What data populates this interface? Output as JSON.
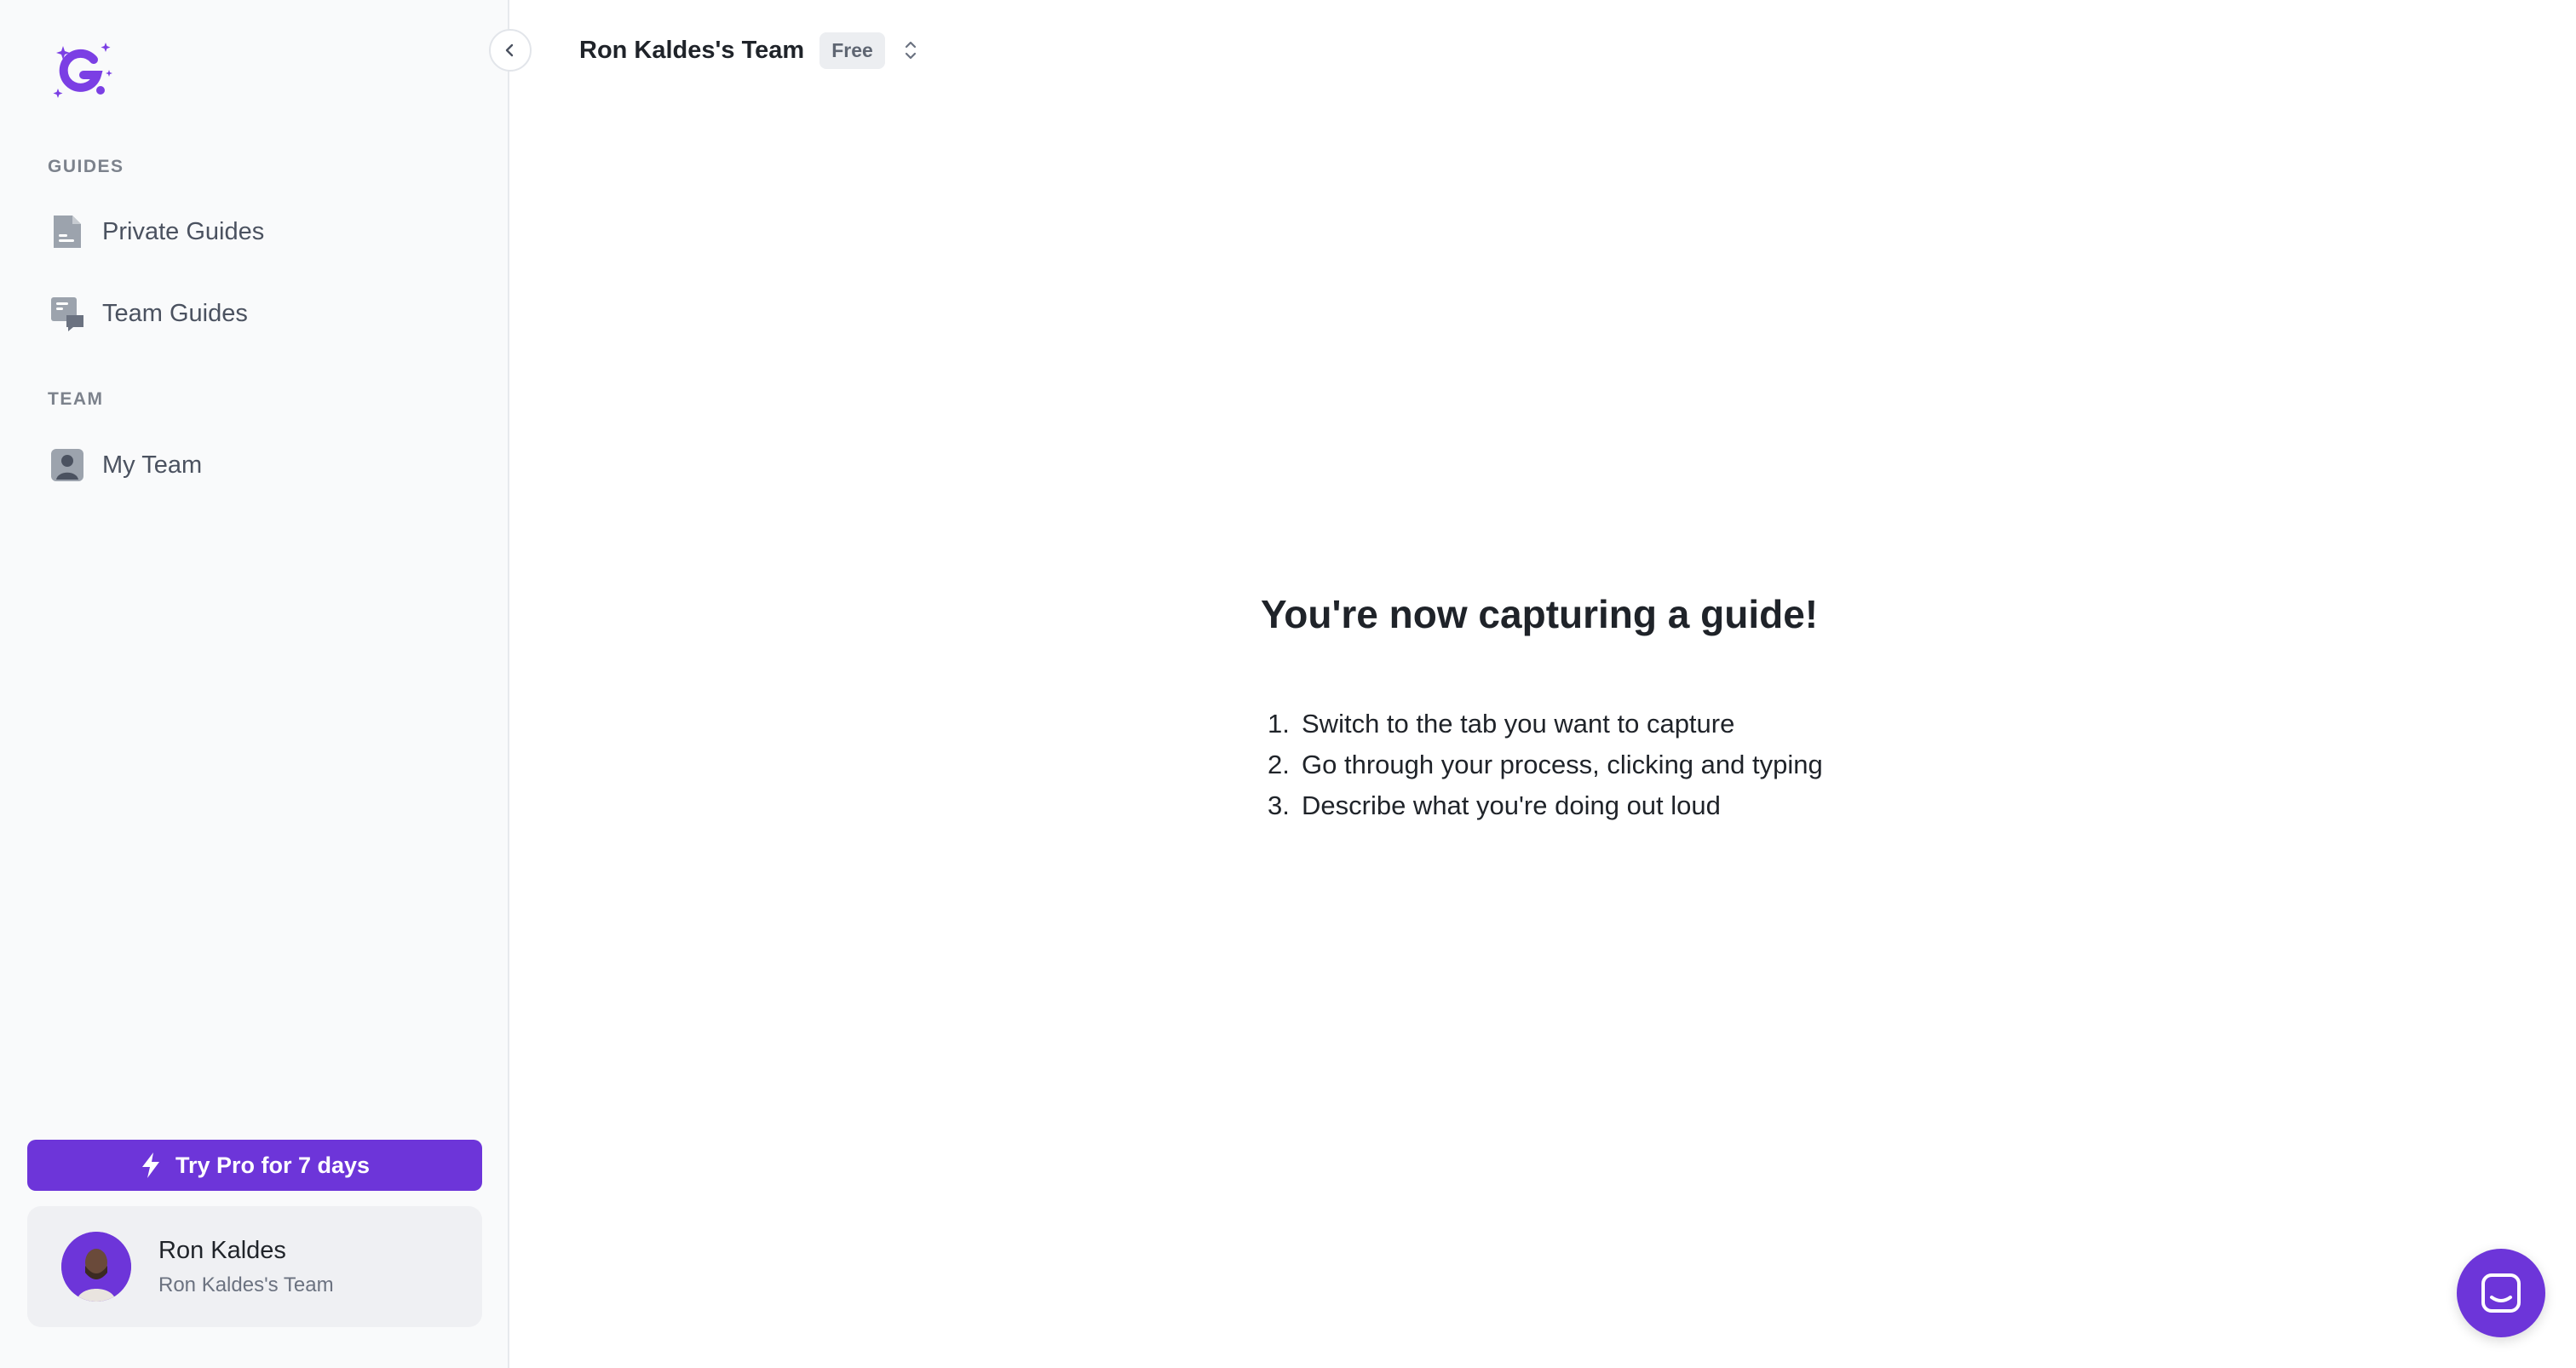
{
  "sidebar": {
    "sections": [
      {
        "label": "GUIDES"
      },
      {
        "label": "TEAM"
      }
    ],
    "items": [
      {
        "label": "Private Guides",
        "icon": "document-icon"
      },
      {
        "label": "Team Guides",
        "icon": "team-guides-icon"
      },
      {
        "label": "My Team",
        "icon": "person-icon"
      }
    ],
    "pro_button": {
      "label": "Try Pro for 7 days",
      "icon": "lightning-icon"
    },
    "user": {
      "name": "Ron Kaldes",
      "team": "Ron Kaldes's Team"
    }
  },
  "header": {
    "team_name": "Ron Kaldes's Team",
    "plan_badge": "Free"
  },
  "main": {
    "title": "You're now capturing a guide!",
    "steps": [
      {
        "num": "1.",
        "text": "Switch to the tab you want to capture"
      },
      {
        "num": "2.",
        "text": "Go through your process, clicking and typing"
      },
      {
        "num": "3.",
        "text": "Describe what you're doing out loud"
      }
    ]
  },
  "colors": {
    "brand": "#6d35d9",
    "sidebar_bg": "#f9fafb",
    "text_primary": "#1f2329",
    "text_muted": "#6b7280"
  }
}
